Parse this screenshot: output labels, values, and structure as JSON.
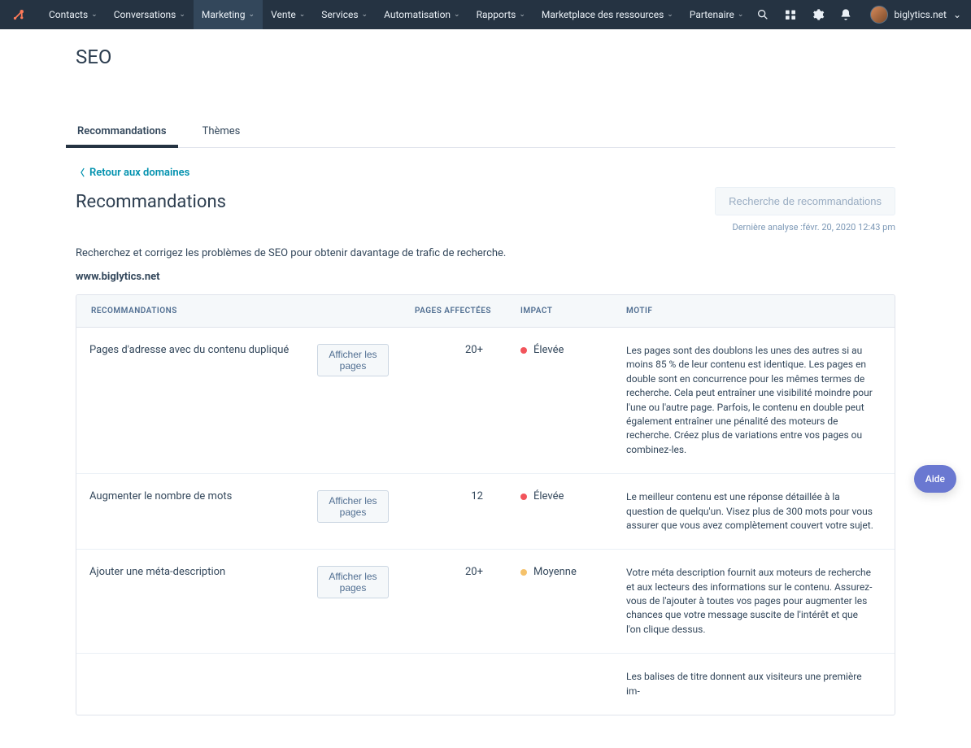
{
  "nav": {
    "items": [
      {
        "label": "Contacts"
      },
      {
        "label": "Conversations"
      },
      {
        "label": "Marketing",
        "active": true
      },
      {
        "label": "Vente"
      },
      {
        "label": "Services"
      },
      {
        "label": "Automatisation"
      },
      {
        "label": "Rapports"
      },
      {
        "label": "Marketplace des ressources"
      },
      {
        "label": "Partenaire"
      }
    ],
    "account_label": "biglytics.net"
  },
  "page": {
    "title": "SEO",
    "tabs": [
      {
        "label": "Recommandations",
        "active": true
      },
      {
        "label": "Thèmes"
      }
    ],
    "back_label": "Retour aux domaines",
    "section_title": "Recommandations",
    "scan_button": "Recherche de recommandations",
    "last_scan_prefix": "Dernière analyse :",
    "last_scan_value": "févr. 20, 2020 12:43 pm",
    "intro": "Recherchez et corrigez les problèmes de SEO pour obtenir davantage de trafic de recherche.",
    "domain": "www.biglytics.net",
    "help_label": "Aide"
  },
  "table": {
    "headers": {
      "rec": "RECOMMANDATIONS",
      "pages": "PAGES AFFECTÉES",
      "impact": "IMPACT",
      "reason": "MOTIF"
    },
    "show_pages_label": "Afficher les pages",
    "impact_levels": {
      "high": "Élevée",
      "medium": "Moyenne"
    },
    "rows": [
      {
        "title": "Pages d'adresse avec du contenu dupliqué",
        "pages": "20+",
        "impact": "high",
        "reason": "Les pages sont des doublons les unes des autres si au moins 85 % de leur contenu est identique. Les pages en double sont en concurrence pour les mêmes termes de recherche. Cela peut entraîner une visibilité moindre pour l'une ou l'autre page. Parfois, le contenu en double peut également entraîner une pénalité des moteurs de recherche. Créez plus de variations entre vos pages ou combinez-les."
      },
      {
        "title": "Augmenter le nombre de mots",
        "pages": "12",
        "impact": "high",
        "reason": "Le meilleur contenu est une réponse détaillée à la question de quelqu'un. Visez plus de 300 mots pour vous assurer que vous avez complètement couvert votre sujet."
      },
      {
        "title": "Ajouter une méta-description",
        "pages": "20+",
        "impact": "medium",
        "reason": "Votre méta description fournit aux moteurs de recherche et aux lecteurs des informations sur le contenu. Assurez-vous de l'ajouter à toutes vos pages pour augmenter les chances que votre message suscite de l'intérêt et que l'on clique dessus."
      },
      {
        "title": "",
        "pages": "",
        "impact": "",
        "reason": "Les balises de titre donnent aux visiteurs une première im-"
      }
    ]
  }
}
